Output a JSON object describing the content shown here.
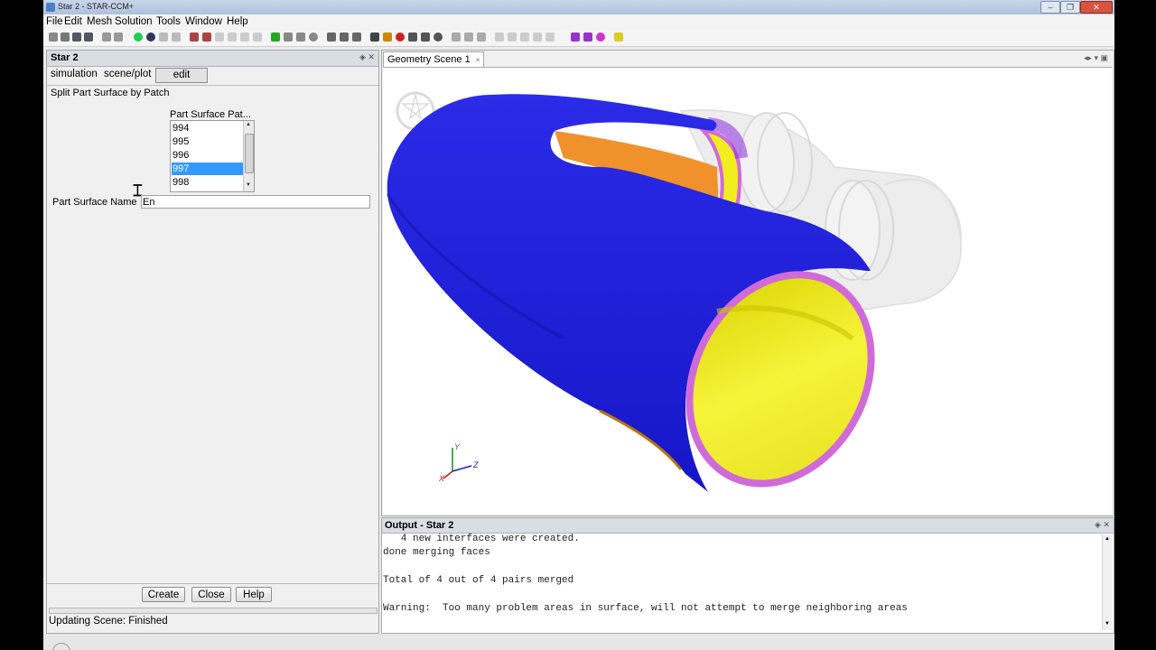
{
  "window": {
    "title": "Star 2 - STAR-CCM+"
  },
  "menubar": {
    "items": [
      "File",
      "Edit",
      "Mesh",
      "Solution",
      "Tools",
      "Window",
      "Help"
    ]
  },
  "left_panel": {
    "title": "Star 2",
    "tabs": {
      "simulation": "simulation",
      "scene_plot": "scene/plot",
      "edit": "edit"
    },
    "form_title": "Split Part Surface by Patch",
    "list_header": "Part Surface Pat...",
    "list_items": [
      "994",
      "995",
      "996",
      "997",
      "998"
    ],
    "selected_item": "997",
    "name_label": "Part Surface Name",
    "name_value": "En",
    "buttons": {
      "create": "Create",
      "close": "Close",
      "help": "Help"
    },
    "status": "Updating Scene: Finished"
  },
  "geometry_panel": {
    "tab_label": "Geometry Scene 1",
    "tab_close": "×",
    "axes": {
      "x": "X",
      "y": "Y",
      "z": "Z"
    },
    "colors": {
      "blue": "#1f1fe0",
      "yellow": "#f2ee1e",
      "orange": "#f0912c",
      "magenta": "#d16ad9"
    }
  },
  "output_panel": {
    "title": "Output - Star 2",
    "lines": [
      "   4 new interfaces were created.",
      "done merging faces",
      "",
      "Total of 4 out of 4 pairs merged",
      "",
      "Warning:  Too many problem areas in surface, will not attempt to merge neighboring areas"
    ]
  }
}
